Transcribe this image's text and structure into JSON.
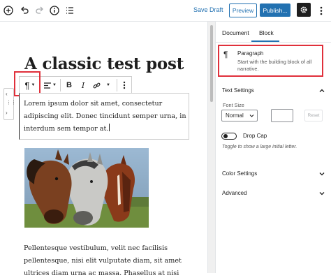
{
  "topbar": {
    "save_draft": "Save Draft",
    "preview": "Preview",
    "publish": "Publish..."
  },
  "editor": {
    "title": "A classic test post",
    "paragraph_lines": [
      "Lorem ipsum dolor sit amet, consectetur",
      "adipiscing elit. Donec tincidunt semper urna, in",
      "interdum sem tempor at."
    ],
    "paragraph2_lines": [
      "Pellentesque vestibulum, velit nec facilisis",
      "pellentesque, nisi elit vulputate diam, sit amet",
      "ultrices diam urna ac massa. Phasellus at nisi"
    ],
    "toolbar": {
      "paragraph_icon": "¶",
      "bold": "B",
      "italic": "I"
    }
  },
  "sidebar": {
    "tabs": [
      {
        "label": "Document"
      },
      {
        "label": "Block"
      }
    ],
    "active_tab": "Block",
    "block_card": {
      "icon": "¶",
      "title": "Paragraph",
      "description": "Start with the building block of all narrative."
    },
    "text_settings": {
      "title": "Text Settings",
      "font_size_label": "Font Size",
      "font_size_value": "Normal",
      "reset": "Reset",
      "drop_cap_label": "Drop Cap",
      "drop_cap_help": "Toggle to show a large initial letter."
    },
    "color_settings": "Color Settings",
    "advanced": "Advanced"
  },
  "colors": {
    "accent": "#2271b1",
    "highlight": "#e0303b",
    "dark": "#1e1e1e"
  }
}
